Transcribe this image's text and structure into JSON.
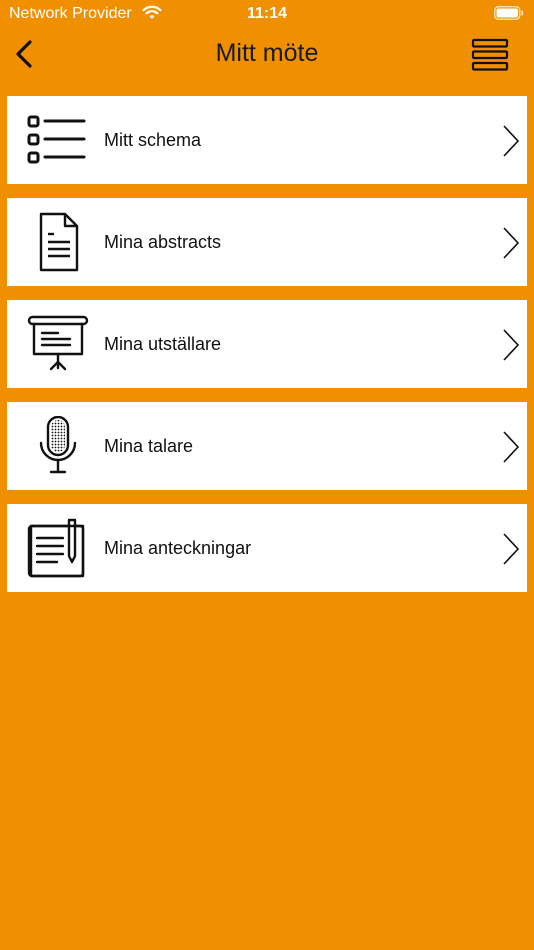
{
  "status_bar": {
    "carrier": "Network Provider",
    "time": "11:14"
  },
  "nav": {
    "title": "Mitt möte",
    "back_icon": "chevron-left-icon",
    "menu_icon": "hamburger-menu-icon"
  },
  "menu": {
    "items": [
      {
        "label": "Mitt schema",
        "icon": "schedule-list-icon"
      },
      {
        "label": "Mina abstracts",
        "icon": "document-icon"
      },
      {
        "label": "Mina utställare",
        "icon": "presentation-board-icon"
      },
      {
        "label": "Mina talare",
        "icon": "microphone-icon"
      },
      {
        "label": "Mina anteckningar",
        "icon": "notes-pencil-icon"
      }
    ]
  },
  "colors": {
    "background": "#F09000",
    "row_background": "#FFFFFF",
    "text": "#111111"
  }
}
